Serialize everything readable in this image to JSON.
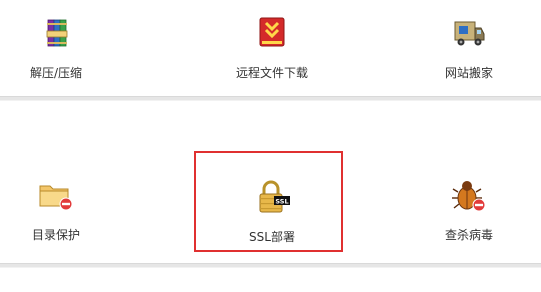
{
  "tools": {
    "unzip": {
      "label": "解压/压缩",
      "icon": "archive-books-icon"
    },
    "remote_download": {
      "label": "远程文件下载",
      "icon": "download-arrow-icon"
    },
    "site_move": {
      "label": "网站搬家",
      "icon": "moving-truck-icon"
    },
    "dir_protect": {
      "label": "目录保护",
      "icon": "folder-forbidden-icon"
    },
    "ssl_deploy": {
      "label": "SSL部署",
      "icon": "ssl-lock-icon",
      "badge": "SSL"
    },
    "virus_scan": {
      "label": "查杀病毒",
      "icon": "bug-forbidden-icon"
    }
  },
  "highlight": {
    "target": "ssl_deploy",
    "color": "#e03030"
  }
}
